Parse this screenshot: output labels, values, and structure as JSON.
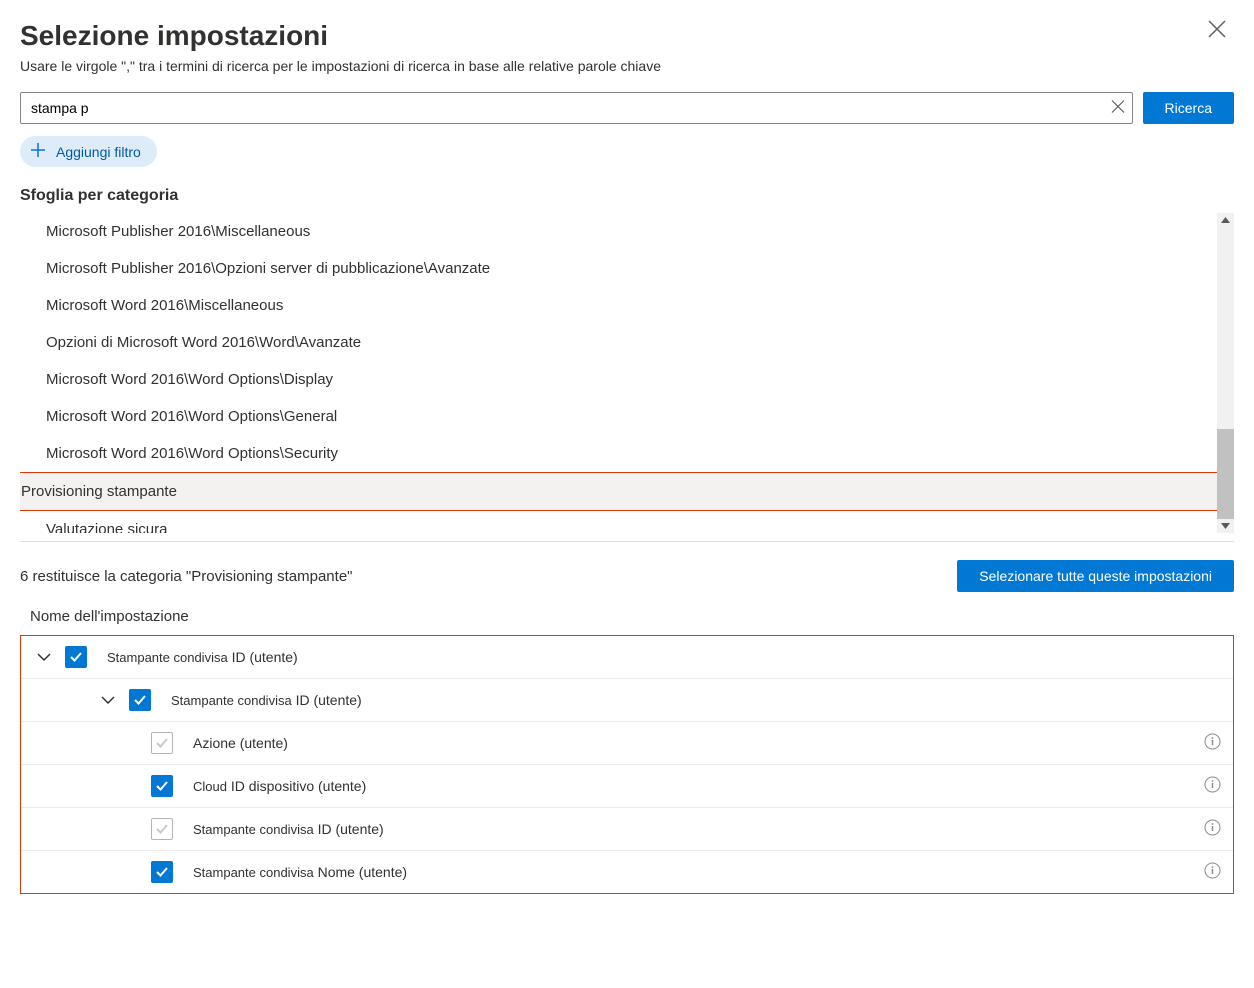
{
  "header": {
    "title": "Selezione impostazioni",
    "subtitle": "Usare le virgole \",\" tra i termini di ricerca per le impostazioni di ricerca in base alle relative parole chiave"
  },
  "search": {
    "value": "stampa p",
    "button": "Ricerca"
  },
  "filter": {
    "add_label": "Aggiungi filtro"
  },
  "browse_label": "Sfoglia per categoria",
  "categories": [
    "Microsoft Publisher 2016\\Miscellaneous",
    "Microsoft Publisher 2016\\Opzioni server di pubblicazione\\Avanzate",
    "Microsoft Word 2016\\Miscellaneous",
    "Opzioni di Microsoft Word 2016\\Word\\Avanzate",
    "Microsoft Word 2016\\Word Options\\Display",
    "Microsoft Word 2016\\Word Options\\General",
    "Microsoft Word 2016\\Word Options\\Security",
    "Provisioning stampante",
    "Valutazione sicura"
  ],
  "results": {
    "text": "6 restituisce la categoria \"Provisioning stampante\"",
    "select_all": "Selezionare tutte queste impostazioni",
    "column": "Nome dell'impostazione"
  },
  "settings": [
    {
      "prefix": "Stampante condivisa",
      "label": " ID (utente)"
    },
    {
      "prefix": "Stampante condivisa",
      "label": " ID (utente)"
    },
    {
      "prefix": "",
      "label": "Azione (utente)"
    },
    {
      "prefix": "Cloud",
      "label": "  ID dispositivo (utente)"
    },
    {
      "prefix": "Stampante condivisa",
      "label": " ID (utente)"
    },
    {
      "prefix": "Stampante condivisa",
      "label": " Nome (utente)"
    }
  ]
}
